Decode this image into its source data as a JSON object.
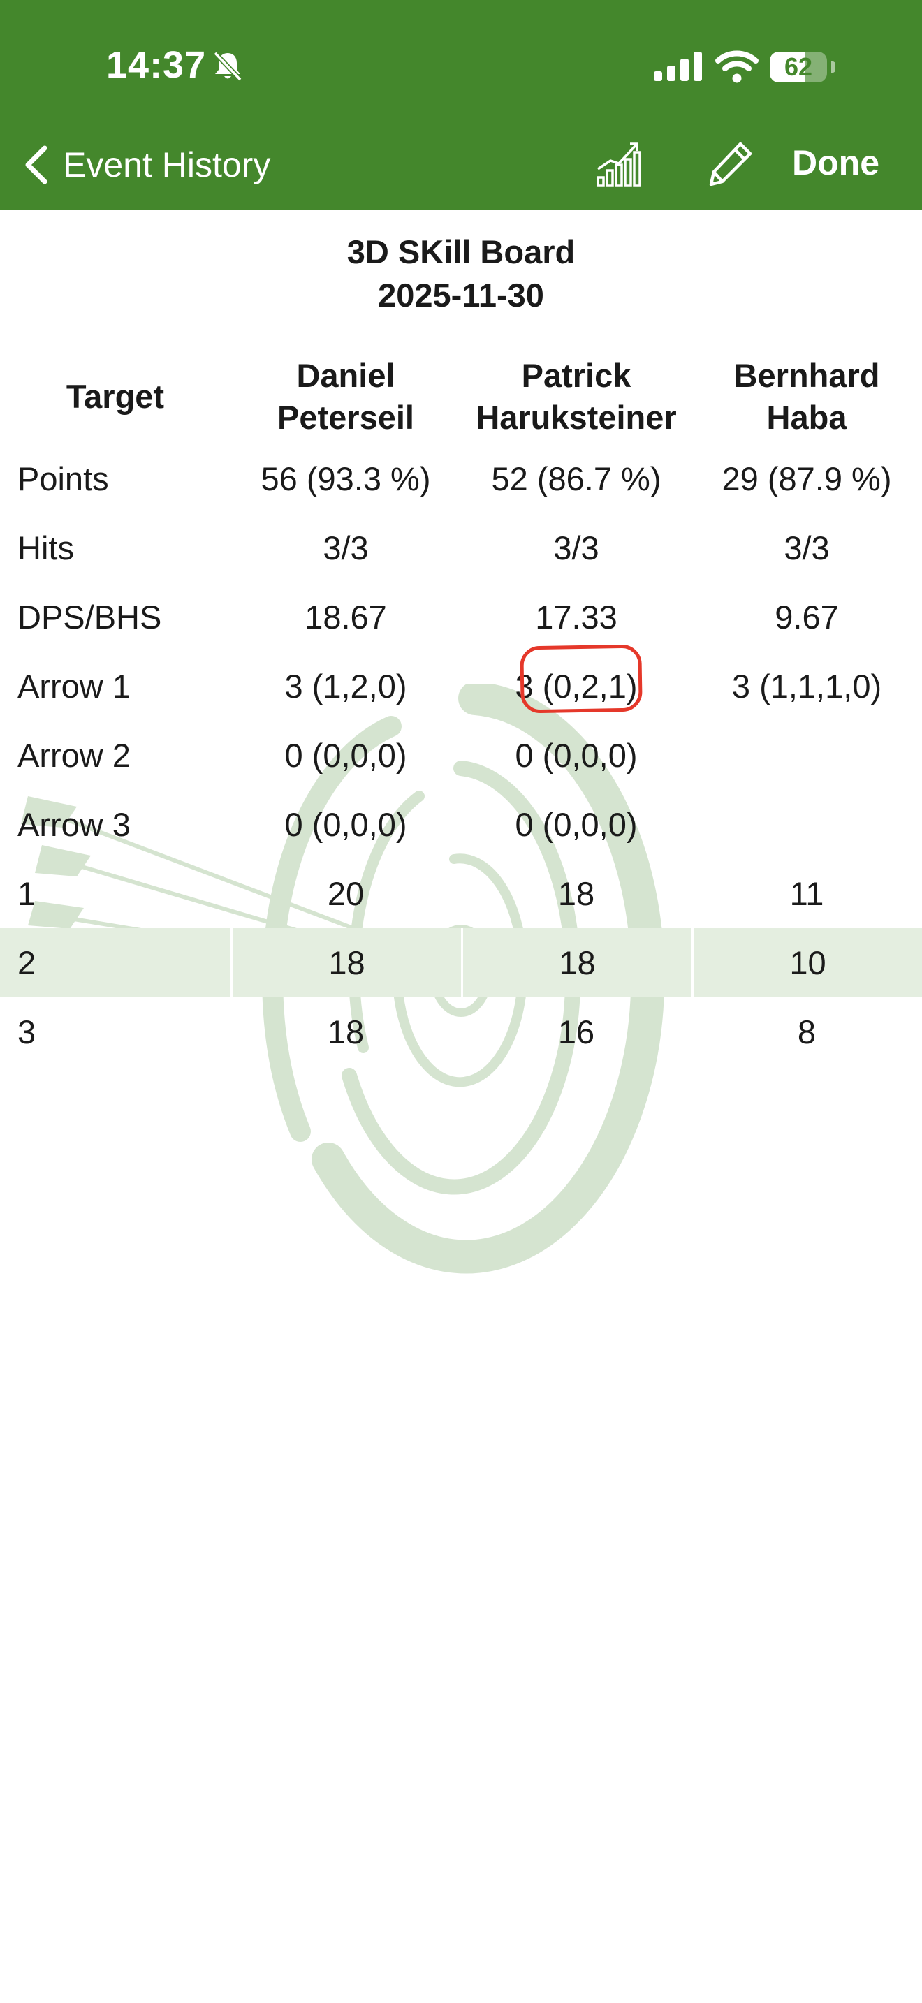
{
  "status_bar": {
    "time": "14:37",
    "battery_level": "62",
    "battery_fraction": 0.62
  },
  "nav": {
    "back_label": "Event History",
    "done_label": "Done"
  },
  "header": {
    "title": "3D SKill Board",
    "date": "2025-11-30"
  },
  "table": {
    "columns": [
      {
        "line1": "Target",
        "line2": ""
      },
      {
        "line1": "Daniel",
        "line2": "Peterseil"
      },
      {
        "line1": "Patrick",
        "line2": "Haruksteiner"
      },
      {
        "line1": "Bernhard",
        "line2": "Haba"
      }
    ],
    "rows": [
      {
        "label": "Points",
        "values": [
          "56 (93.3 %)",
          "52 (86.7 %)",
          "29 (87.9 %)"
        ]
      },
      {
        "label": "Hits",
        "values": [
          "3/3",
          "3/3",
          "3/3"
        ]
      },
      {
        "label": "DPS/BHS",
        "values": [
          "18.67",
          "17.33",
          "9.67"
        ]
      },
      {
        "label": "Arrow 1",
        "values": [
          "3 (1,2,0)",
          "3 (0,2,1)",
          "3 (1,1,1,0)"
        ]
      },
      {
        "label": "Arrow 2",
        "values": [
          "0 (0,0,0)",
          "0 (0,0,0)",
          ""
        ]
      },
      {
        "label": "Arrow 3",
        "values": [
          "0 (0,0,0)",
          "0 (0,0,0)",
          ""
        ]
      },
      {
        "label": "1",
        "values": [
          "20",
          "18",
          "11"
        ]
      },
      {
        "label": "2",
        "values": [
          "18",
          "18",
          "10"
        ]
      },
      {
        "label": "3",
        "values": [
          "18",
          "16",
          "8"
        ]
      }
    ],
    "highlighted_row": "2"
  },
  "colors": {
    "header_green": "#44872c",
    "row_highlight": "#e4eee0",
    "annotation_red": "#e5382a"
  }
}
